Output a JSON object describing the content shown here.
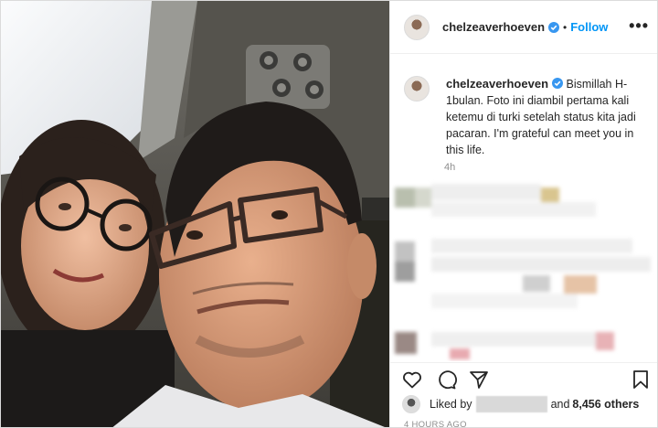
{
  "post": {
    "username": "chelzeaverhoeven",
    "follow_label": "Follow",
    "dot": "•",
    "more_label": "•••",
    "caption": "Bismillah H-1bulan. Foto ini diambil pertama kali ketemu di turki setelah status kita jadi pacaran. I'm grateful can meet you in this life.",
    "caption_time": "4h",
    "likes_prefix": "Liked by",
    "likes_and": "and",
    "likes_count": "8,456 others",
    "posted_ago": "4 HOURS AGO"
  },
  "icons": [
    "verified-badge-icon",
    "heart-icon",
    "comment-icon",
    "share-icon",
    "bookmark-icon"
  ],
  "colors": {
    "accent": "#0095f6",
    "muted": "#8e8e8e",
    "text": "#262626",
    "border": "#dbdbdb"
  }
}
